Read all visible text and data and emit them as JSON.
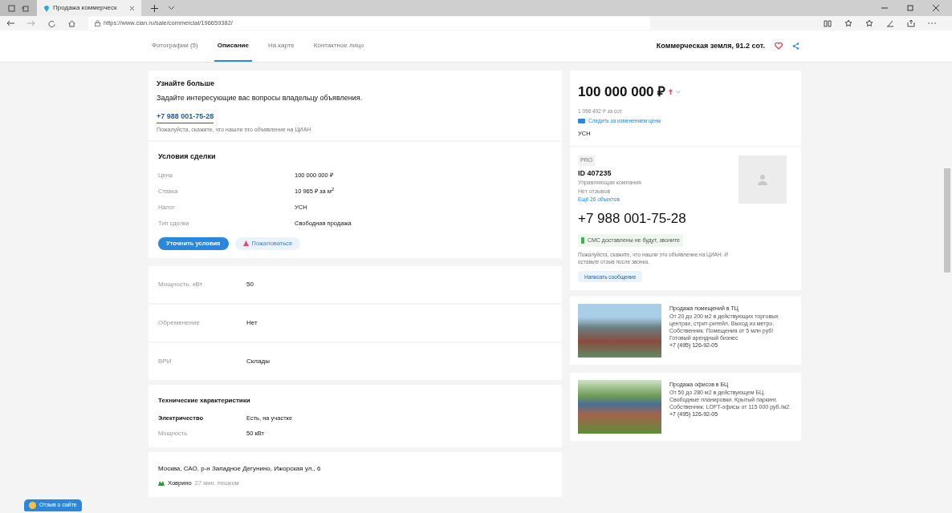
{
  "browser": {
    "tab_title": "Продажа коммерческ",
    "url": "https://www.cian.ru/sale/commercial/196659382/"
  },
  "nav": {
    "tabs": [
      {
        "label": "Фотографии (5)",
        "selected": false
      },
      {
        "label": "Описание",
        "selected": true
      },
      {
        "label": "На карте",
        "selected": false
      },
      {
        "label": "Контактное лицо",
        "selected": false
      }
    ],
    "title": "Коммерческая земля, 91.2 сот."
  },
  "contact": {
    "heading": "Узнайте больше",
    "text": "Задайте интересующие вас вопросы владельцу объявления.",
    "phone": "+7 988 001-75-28",
    "note": "Пожалуйста, скажите, что нашли это объявление на ЦИАН"
  },
  "terms": {
    "heading": "Условия сделки",
    "rows": [
      {
        "label": "Цена",
        "value": "100 000 000 ₽"
      },
      {
        "label": "Ставка",
        "value": "10 965 ₽ за м$^{2}$"
      },
      {
        "label": "Налог",
        "value": "УСН"
      },
      {
        "label": "Тип сделки",
        "value": "Свободная продажа"
      }
    ],
    "primary_button": "Уточнить условия",
    "complain_button": "Пожаловаться"
  },
  "params": [
    {
      "label": "Мощность, кВт",
      "value": "50"
    },
    {
      "label": "Обременение",
      "value": "Нет"
    },
    {
      "label": "ВРИ",
      "value": "Склады"
    }
  ],
  "tech": {
    "heading": "Технические характеристики",
    "rows": [
      {
        "label": "Электричество",
        "value": "Есть, на участке",
        "kind": "main"
      },
      {
        "label": "Мощность",
        "value": "50 кВт",
        "kind": "sub"
      }
    ]
  },
  "address": {
    "text": "Москва, САО, р-н Западное Дегунино, Ижорская ул., 6",
    "metro": "Ховрино",
    "walk": "27 мин. пешком"
  },
  "price": {
    "value": "100 000 000 ₽",
    "per_unit": "1 096 492 ₽ за сот.",
    "watch_link": "Следить за изменением цены",
    "tax": "УСН"
  },
  "seller": {
    "badge": "PRO",
    "id": "ID 407235",
    "type": "Управляющая компания",
    "reviews": "Нет отзывов",
    "more_link": "Ещё 26 объектов",
    "phone": "+7 988 001-75-28",
    "sms_note": "СМС доставлены не будут, звоните",
    "note": "Пожалуйста, скажите, что нашли это объявление на ЦИАН. И оставьте отзыв после звонка.",
    "message_button": "Написать сообщение"
  },
  "ads": [
    {
      "title": "Продажа помещений в ТЦ",
      "text": "От 20 до 200 м2 в действующих торговых центрах, стрит-ритейл. Выход из метро. Собственник. Помещения от 5 млн руб! Готовый арендный бизнес",
      "phone": "+7 (495) 126-92-05"
    },
    {
      "title": "Продажа офисов в БЦ",
      "text": "От 50 до 280 м2 в действующем БЦ. Свободные планировки. Крытый паркинг. Собственник. LOFT-офисы от 115 000 руб./м2.",
      "phone": "+7 (495) 126-92-05"
    }
  ],
  "feedback_button": "Отзыв о сайте"
}
